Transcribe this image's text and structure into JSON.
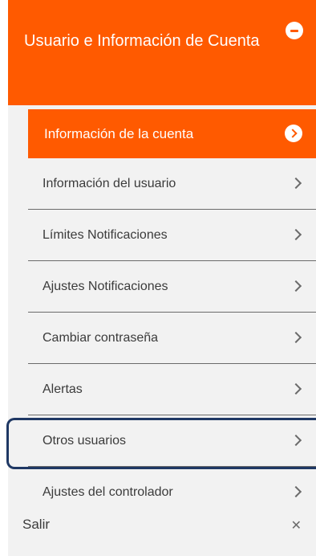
{
  "header": {
    "title": "Usuario e Información de Cuenta",
    "icon": "minus-circle-icon"
  },
  "active_item": {
    "label": "Información de la cuenta",
    "icon": "chevron-right-circle-icon"
  },
  "menu": {
    "items": [
      {
        "label": "Información del usuario"
      },
      {
        "label": "Límites Notificaciones"
      },
      {
        "label": "Ajustes Notificaciones"
      },
      {
        "label": "Cambiar contraseña"
      },
      {
        "label": "Alertas"
      },
      {
        "label": "Otros usuarios",
        "highlighted": true
      },
      {
        "label": "Ajustes del controlador"
      }
    ]
  },
  "exit": {
    "label": "Salir",
    "icon": "close-icon"
  },
  "colors": {
    "accent": "#ff5a00",
    "panel_bg": "#f2f2f2",
    "highlight_border": "#1f3864",
    "text": "#3b3b3b"
  }
}
